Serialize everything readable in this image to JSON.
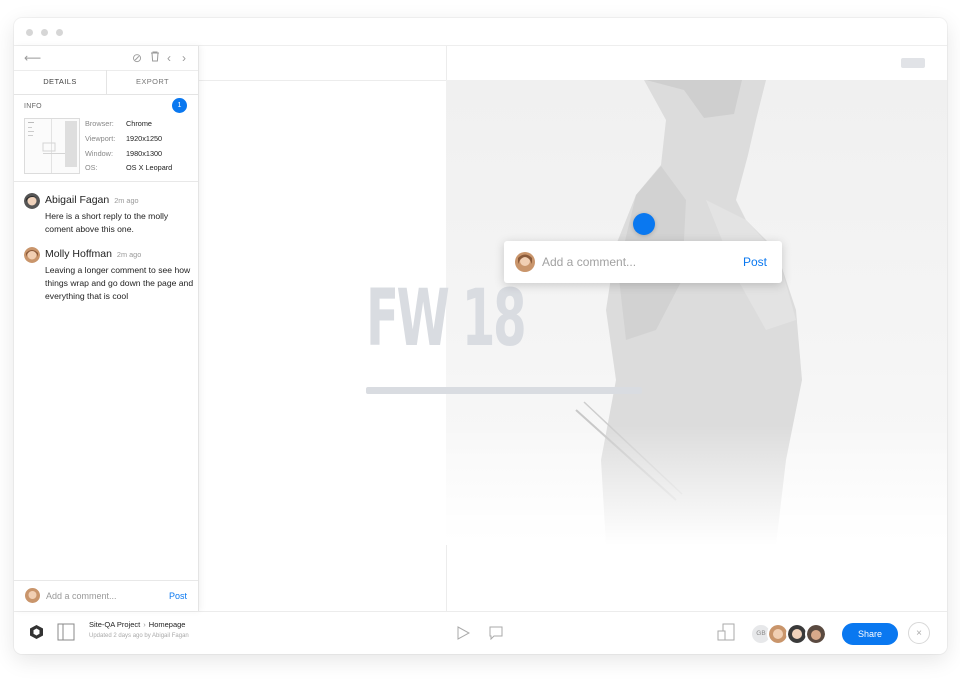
{
  "panel": {
    "tabs": [
      "DETAILS",
      "EXPORT"
    ],
    "info_label": "INFO",
    "info_count": "1",
    "info": [
      {
        "key": "Browser:",
        "value": "Chrome"
      },
      {
        "key": "Viewport:",
        "value": "1920x1250"
      },
      {
        "key": "Window:",
        "value": "1980x1300"
      },
      {
        "key": "OS:",
        "value": "OS X Leopard"
      }
    ],
    "comments": [
      {
        "author": "Abigail Fagan",
        "time": "2m ago",
        "text": "Here is a short reply to the molly coment above this one."
      },
      {
        "author": "Molly Hoffman",
        "time": "2m ago",
        "text": "Leaving a longer comment to see how things wrap and go down the page and everything that is cool"
      }
    ],
    "footer": {
      "placeholder": "Add a comment...",
      "post": "Post"
    }
  },
  "canvas": {
    "hero_text": "FW 18"
  },
  "popup": {
    "placeholder": "Add a comment...",
    "post": "Post"
  },
  "bottombar": {
    "project": "Site-QA Project",
    "page": "Homepage",
    "subtitle": "Updated 2 days ago by Abigail Fagan",
    "initials": "GB",
    "share": "Share",
    "close": "×"
  },
  "colors": {
    "accent": "#0a78f0"
  }
}
